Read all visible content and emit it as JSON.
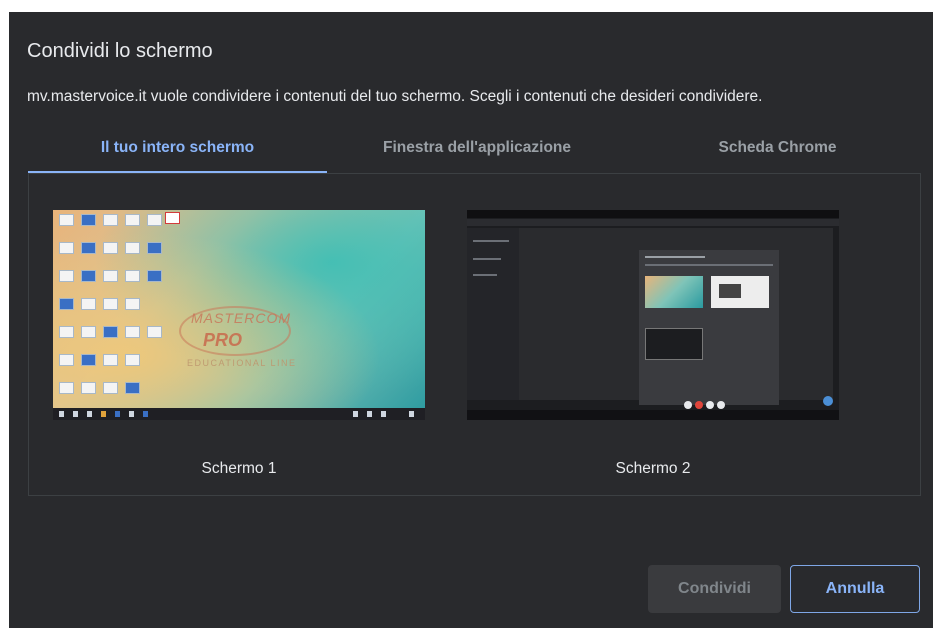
{
  "dialog": {
    "title": "Condividi lo schermo",
    "description": "mv.mastervoice.it vuole condividere i contenuti del tuo schermo. Scegli i contenuti che desideri condividere."
  },
  "tabs": [
    {
      "label": "Il tuo intero schermo",
      "selected": true
    },
    {
      "label": "Finestra dell'applicazione",
      "selected": false
    },
    {
      "label": "Scheda Chrome",
      "selected": false
    }
  ],
  "sources": [
    {
      "label": "Schermo 1",
      "thumbnail": "desktop-wallpaper"
    },
    {
      "label": "Schermo 2",
      "thumbnail": "browser-window"
    }
  ],
  "thumbnail1_text": {
    "logo": "MASTERCOM",
    "logo_sub": "PRO",
    "logo_edu": "EDUCATIONAL LINE"
  },
  "buttons": {
    "share_label": "Condividi",
    "share_enabled": false,
    "cancel_label": "Annulla"
  },
  "colors": {
    "dialog_bg": "#292a2d",
    "accent": "#8ab4f8",
    "text": "#e8eaed",
    "muted": "#9aa0a6"
  }
}
